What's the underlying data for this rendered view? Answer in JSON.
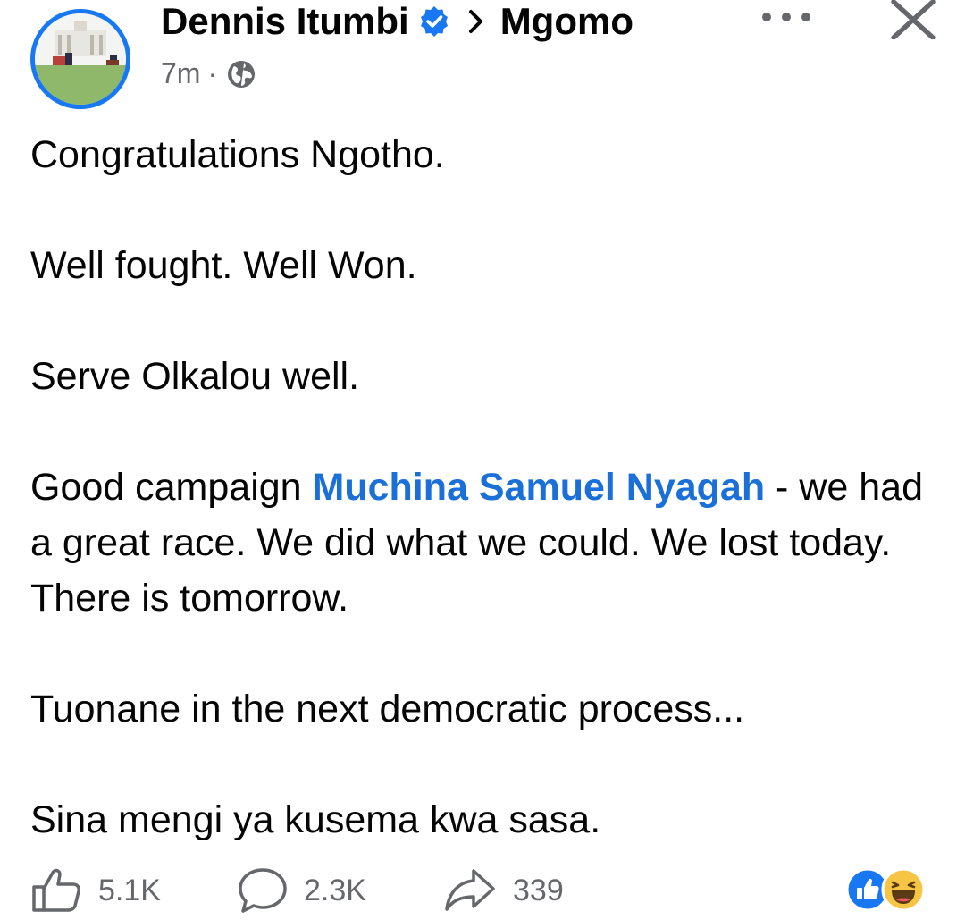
{
  "post": {
    "author_name": "Dennis Itumbi",
    "group_name": "Mgomo",
    "timestamp": "7m",
    "meta_separator": "·",
    "paragraphs": {
      "p1": "Congratulations Ngotho.",
      "p2": "Well fought. Well Won.",
      "p3": "Serve Olkalou well.",
      "p4_before": "Good campaign ",
      "p4_mention": "Muchina Samuel Nyagah",
      "p4_after": " - we had a great race. We did what we could. We lost today. There is tomorrow.",
      "p5": "Tuonane in the next democratic process...",
      "p6": "Sina mengi ya kusema kwa sasa."
    }
  },
  "stats": {
    "likes": "5.1K",
    "comments": "2.3K",
    "shares": "339"
  },
  "icons": {
    "avatar": "avatar-photo",
    "verified": "verified-badge-icon",
    "chevron": "chevron-right-icon",
    "privacy": "globe-icon",
    "more": "more-options-icon",
    "close": "close-icon",
    "like": "thumbs-up-icon",
    "comment": "comment-bubble-icon",
    "share": "share-arrow-icon",
    "reaction_like": "like-reaction-icon",
    "reaction_haha": "haha-reaction-icon"
  },
  "colors": {
    "brand_blue": "#1877f2",
    "mention_blue": "#1b6fd8",
    "text": "#050505",
    "secondary_text": "#65676b",
    "haha_yellow": "#f7c544"
  }
}
